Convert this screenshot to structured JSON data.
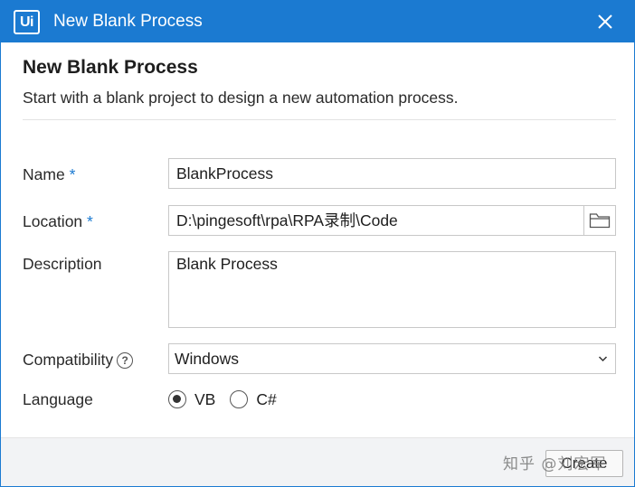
{
  "window": {
    "logo_text": "Ui",
    "title": "New Blank Process"
  },
  "header": {
    "heading": "New Blank Process",
    "subheading": "Start with a blank project to design a new automation process."
  },
  "form": {
    "name_label": "Name",
    "name_required": "*",
    "name_value": "BlankProcess",
    "location_label": "Location",
    "location_required": "*",
    "location_value": "D:\\pingesoft\\rpa\\RPA录制\\Code",
    "description_label": "Description",
    "description_value": "Blank Process",
    "compatibility_label": "Compatibility",
    "compatibility_help": "?",
    "compatibility_value": "Windows",
    "language_label": "Language",
    "language_options": [
      {
        "label": "VB",
        "selected": true
      },
      {
        "label": "C#",
        "selected": false
      }
    ]
  },
  "footer": {
    "create_label": "Create",
    "watermark": "知乎 @刘宏军"
  },
  "colors": {
    "titlebar": "#1b7ad1",
    "required_marker": "#1b7ad1",
    "footer_bg": "#f2f3f5"
  },
  "icons": {
    "logo": "uipath-logo-icon",
    "close": "close-icon",
    "folder": "folder-icon",
    "help": "help-circle-icon",
    "dropdown": "chevron-down-icon"
  }
}
